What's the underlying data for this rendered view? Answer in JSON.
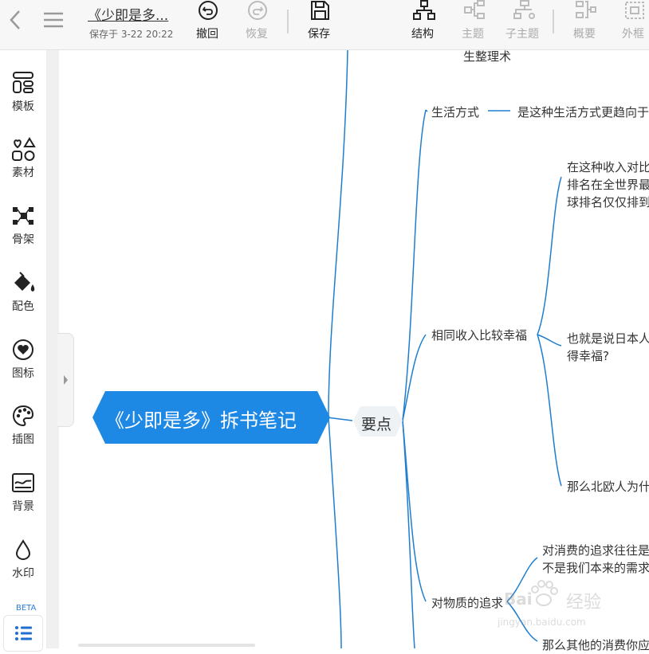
{
  "header": {
    "doc_title": "《少即是多...",
    "save_status": "保存于 3-22 20:22",
    "toolbar": [
      {
        "id": "undo",
        "label": "撤回",
        "icon": "undo-icon",
        "enabled": true
      },
      {
        "id": "redo",
        "label": "恢复",
        "icon": "redo-icon",
        "enabled": false
      },
      {
        "id": "save",
        "label": "保存",
        "icon": "save-icon",
        "enabled": true
      },
      {
        "id": "structure",
        "label": "结构",
        "icon": "structure-icon",
        "enabled": true
      },
      {
        "id": "topic",
        "label": "主题",
        "icon": "topic-icon",
        "enabled": false
      },
      {
        "id": "subtopic",
        "label": "子主题",
        "icon": "subtopic-icon",
        "enabled": false
      },
      {
        "id": "summary",
        "label": "概要",
        "icon": "summary-icon",
        "enabled": false
      },
      {
        "id": "frame",
        "label": "外框",
        "icon": "frame-icon",
        "enabled": false
      }
    ]
  },
  "sidebar": {
    "items": [
      {
        "label": "模板",
        "icon": "template-icon"
      },
      {
        "label": "素材",
        "icon": "shapes-icon"
      },
      {
        "label": "骨架",
        "icon": "skeleton-icon"
      },
      {
        "label": "配色",
        "icon": "paint-bucket-icon"
      },
      {
        "label": "图标",
        "icon": "heart-icon"
      },
      {
        "label": "插图",
        "icon": "palette-icon"
      },
      {
        "label": "背景",
        "icon": "background-icon"
      },
      {
        "label": "水印",
        "icon": "droplet-icon"
      }
    ],
    "beta_label": "BETA",
    "bottom_button_icon": "outline-list-icon"
  },
  "mindmap": {
    "root": "《少即是多》拆书笔记",
    "subtopic": "要点",
    "partial_top_node": "生整理术",
    "branches": [
      {
        "title": "生活方式",
        "children": [
          "是这种生活方式更趋向于"
        ]
      },
      {
        "title": "相同收入比较幸福",
        "children": [
          "在这种收入对比\n排名在全世界最\n球排名仅仅排到",
          "也就是说日本人\n得幸福?",
          "那么北欧人为什"
        ]
      },
      {
        "title": "对物质的追求",
        "children": [
          "对消费的追求往往是\n不是我们本来的需求",
          "那么其他的消费你应"
        ]
      }
    ]
  },
  "watermark": {
    "brand": "Bai",
    "cn": "经验",
    "url": "jingyan.baidu.com"
  },
  "colors": {
    "accent": "#1e88e5",
    "line": "#1e7ed0",
    "toolbar_bg": "#f7f7f7",
    "disabled": "#aaaaaa"
  }
}
